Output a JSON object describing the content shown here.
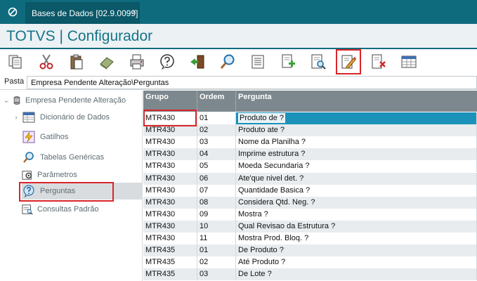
{
  "tab": {
    "label": "Bases de Dados [02.9.0099]",
    "close": "×"
  },
  "app_title": "TOTVS | Configurador",
  "toolbar": {
    "buttons": [
      "copy-icon",
      "cut-icon",
      "paste-icon",
      "eraser-icon",
      "print-icon",
      "help-icon",
      "exit-icon",
      "search-icon",
      "list-icon",
      "add-document-icon",
      "preview-icon",
      "edit-icon",
      "delete-icon",
      "table-icon"
    ],
    "highlighted": "edit-icon"
  },
  "path": {
    "label": "Pasta",
    "value": "Empresa Pendente Alteração\\Perguntas"
  },
  "tree": {
    "root": "Empresa Pendente Alteração",
    "items": [
      {
        "label": "Dicionário de Dados",
        "icon": "table-icon"
      },
      {
        "label": "Gatilhos",
        "icon": "lightning-icon"
      },
      {
        "label": "Tabelas Genéricas",
        "icon": "magnifier-icon"
      },
      {
        "label": "Parâmetros",
        "icon": "parameters-icon"
      },
      {
        "label": "Perguntas",
        "icon": "question-icon"
      },
      {
        "label": "Consultas Padrão",
        "icon": "query-icon"
      }
    ],
    "selected": "Perguntas"
  },
  "grid": {
    "columns": [
      "Grupo",
      "Ordem",
      "Pergunta"
    ],
    "rows": [
      [
        "MTR430",
        "01",
        "Produto de ?"
      ],
      [
        "MTR430",
        "02",
        "Produto ate ?"
      ],
      [
        "MTR430",
        "03",
        "Nome da Planilha ?"
      ],
      [
        "MTR430",
        "04",
        "Imprime estrutura ?"
      ],
      [
        "MTR430",
        "05",
        "Moeda Secundaria ?"
      ],
      [
        "MTR430",
        "06",
        "Ate'que nivel det. ?"
      ],
      [
        "MTR430",
        "07",
        "Quantidade Basica ?"
      ],
      [
        "MTR430",
        "08",
        "Considera Qtd. Neg. ?"
      ],
      [
        "MTR430",
        "09",
        "Mostra ?"
      ],
      [
        "MTR430",
        "10",
        "Qual Revisao da Estrutura ?"
      ],
      [
        "MTR430",
        "11",
        "Mostra Prod. Bloq. ?"
      ],
      [
        "MTR435",
        "01",
        "De  Produto ?"
      ],
      [
        "MTR435",
        "02",
        "Até Produto ?"
      ],
      [
        "MTR435",
        "03",
        "De  Lote ?"
      ]
    ],
    "selected_row": 0
  },
  "colors": {
    "brand": "#0e6b7d",
    "accent": "#1b92b9",
    "highlight": "#d9252a"
  }
}
